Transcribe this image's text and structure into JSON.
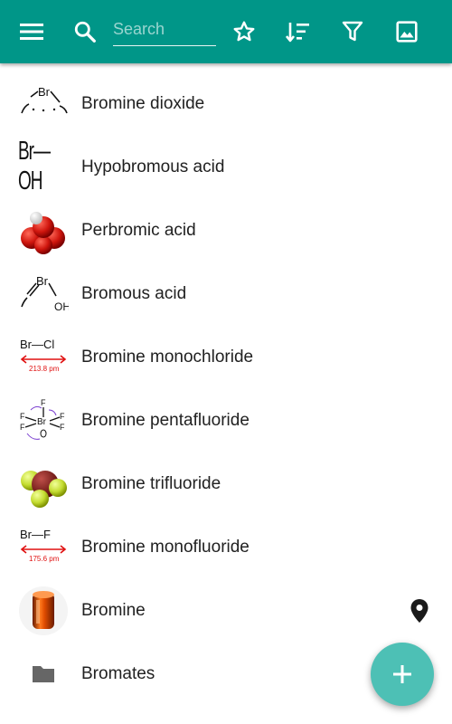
{
  "toolbar": {
    "search_placeholder": "Search",
    "search_value": "",
    "menu_icon": "menu-icon",
    "search_icon": "search-icon",
    "star_icon": "star-outline-icon",
    "sort_icon": "sort-icon",
    "filter_icon": "filter-icon",
    "image_icon": "image-icon",
    "background": "#009688"
  },
  "list": {
    "items": [
      {
        "label": "Bromine dioxide",
        "thumb_text": "Br"
      },
      {
        "label": "Hypobromous acid",
        "thumb_text": "Br—OH"
      },
      {
        "label": "Perbromic acid"
      },
      {
        "label": "Bromous acid",
        "thumb_text": "Br"
      },
      {
        "label": "Bromine monochloride",
        "thumb_text": "Br—Cl",
        "thumb_caption": "213.8 pm"
      },
      {
        "label": "Bromine pentafluoride",
        "thumb_text": "Br"
      },
      {
        "label": "Bromine trifluoride"
      },
      {
        "label": "Bromine monofluoride",
        "thumb_text": "Br—F",
        "thumb_caption": "175.6 pm"
      },
      {
        "label": "Bromine",
        "trailing_icon": "location-pin-icon"
      },
      {
        "label": "Bromates",
        "thumb_icon": "folder-icon"
      }
    ]
  },
  "fab": {
    "icon": "add-icon",
    "color": "#4dc0b5"
  }
}
